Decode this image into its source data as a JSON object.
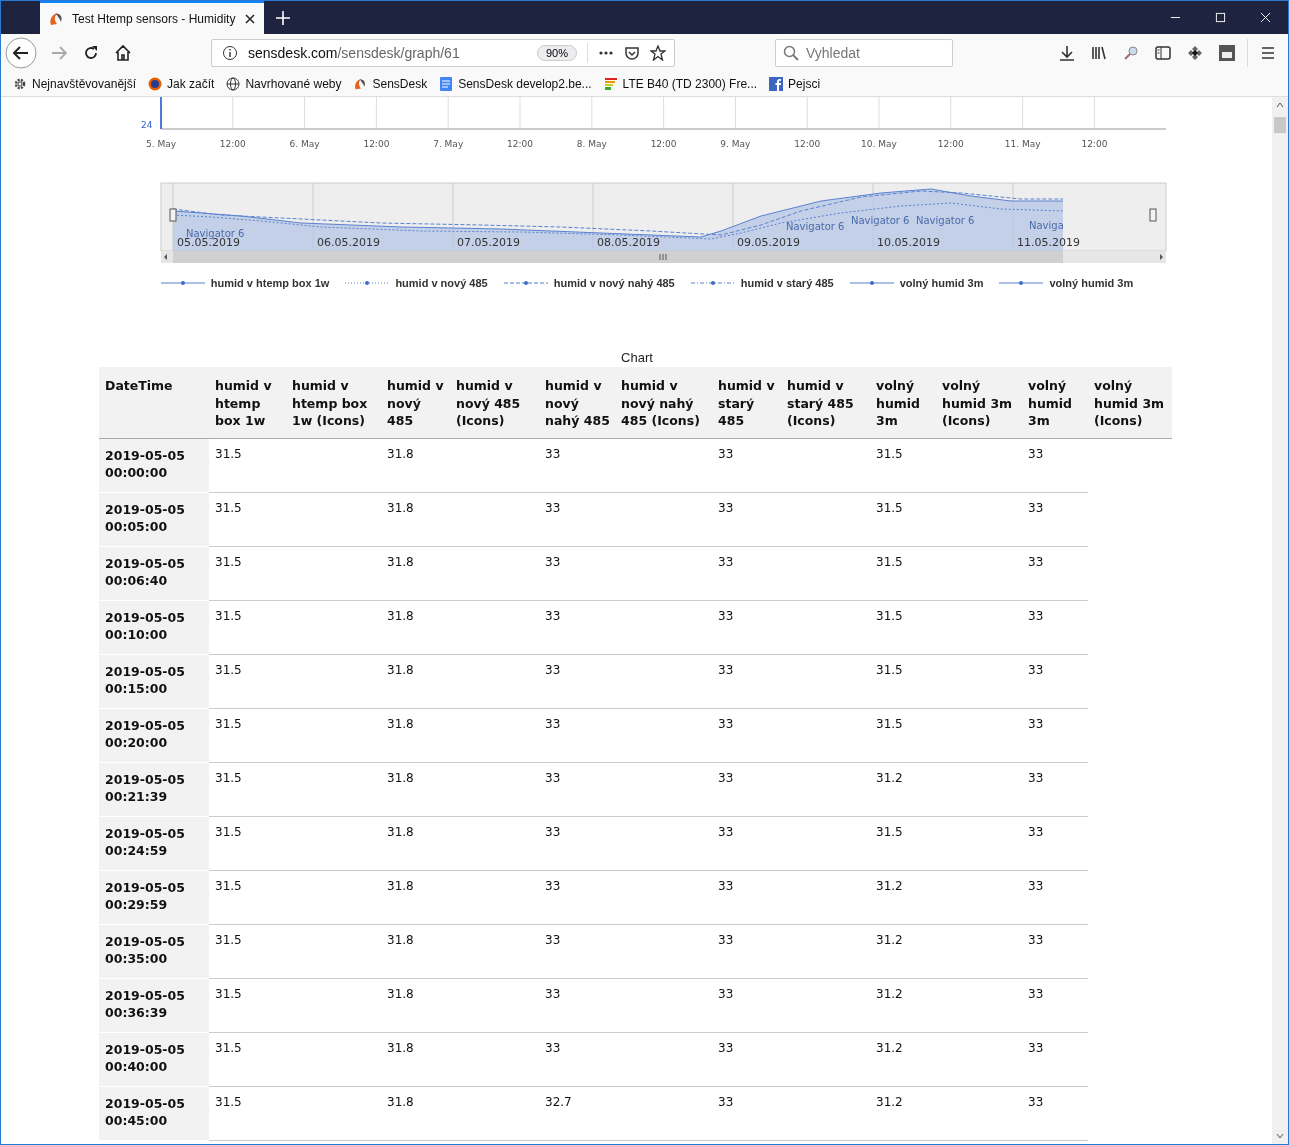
{
  "browser": {
    "tab_title": "Test Htemp sensors - Humidity",
    "url_host": "sensdesk.com",
    "url_path": "/sensdesk/graph/61",
    "zoom": "90%",
    "search_placeholder": "Vyhledat",
    "bookmarks": [
      "Nejnavštěvovanější",
      "Jak začít",
      "Navrhované weby",
      "SensDesk",
      "SensDesk develop2.be...",
      "LTE B40 (TD 2300) Fre...",
      "Pejsci"
    ]
  },
  "chart": {
    "y_label": "24",
    "x_labels": [
      "5. May",
      "12:00",
      "6. May",
      "12:00",
      "7. May",
      "12:00",
      "8. May",
      "12:00",
      "9. May",
      "12:00",
      "10. May",
      "12:00",
      "11. May",
      "12:00"
    ],
    "navigator": {
      "dates": [
        "05.05.2019",
        "06.05.2019",
        "07.05.2019",
        "08.05.2019",
        "09.05.2019",
        "10.05.2019",
        "11.05.2019"
      ],
      "series_labels": [
        "Navigator 6",
        "Navigator 6",
        "Navigator 6",
        "Navigator 6",
        "Naviga"
      ]
    },
    "legend": [
      {
        "name": "humid v htemp box 1w",
        "kind": "solid"
      },
      {
        "name": "humid v nový 485",
        "kind": "dotted"
      },
      {
        "name": "humid v nový nahý 485",
        "kind": "dashed"
      },
      {
        "name": "humid v starý 485",
        "kind": "dashdot"
      },
      {
        "name": "volný humid 3m",
        "kind": "solid"
      },
      {
        "name": "volný humid 3m",
        "kind": "solid"
      }
    ]
  },
  "table": {
    "caption": "Chart",
    "columns": [
      {
        "label": "DateTime",
        "kind": "datetime"
      },
      {
        "label": "humid v htemp box 1w",
        "kind": "value"
      },
      {
        "label": "humid v htemp box 1w (Icons)",
        "kind": "icons"
      },
      {
        "label": "humid v nový 485",
        "kind": "value"
      },
      {
        "label": "humid v nový 485 (Icons)",
        "kind": "icons"
      },
      {
        "label": "humid v nový nahý 485",
        "kind": "value"
      },
      {
        "label": "humid v nový nahý 485 (Icons)",
        "kind": "icons"
      },
      {
        "label": "humid v starý 485",
        "kind": "value"
      },
      {
        "label": "humid v starý 485 (Icons)",
        "kind": "icons"
      },
      {
        "label": "volný humid 3m",
        "kind": "value"
      },
      {
        "label": "volný humid 3m (Icons)",
        "kind": "icons"
      },
      {
        "label": "volný humid 3m",
        "kind": "value"
      },
      {
        "label": "volný humid 3m (Icons)",
        "kind": "icons"
      }
    ],
    "rows": [
      {
        "datetime": "2019-05-05 00:00:00",
        "values": [
          "31.5",
          "31.8",
          "33",
          "33",
          "31.5",
          "33"
        ]
      },
      {
        "datetime": "2019-05-05 00:05:00",
        "values": [
          "31.5",
          "31.8",
          "33",
          "33",
          "31.5",
          "33"
        ]
      },
      {
        "datetime": "2019-05-05 00:06:40",
        "values": [
          "31.5",
          "31.8",
          "33",
          "33",
          "31.5",
          "33"
        ]
      },
      {
        "datetime": "2019-05-05 00:10:00",
        "values": [
          "31.5",
          "31.8",
          "33",
          "33",
          "31.5",
          "33"
        ]
      },
      {
        "datetime": "2019-05-05 00:15:00",
        "values": [
          "31.5",
          "31.8",
          "33",
          "33",
          "31.5",
          "33"
        ]
      },
      {
        "datetime": "2019-05-05 00:20:00",
        "values": [
          "31.5",
          "31.8",
          "33",
          "33",
          "31.5",
          "33"
        ]
      },
      {
        "datetime": "2019-05-05 00:21:39",
        "values": [
          "31.5",
          "31.8",
          "33",
          "33",
          "31.2",
          "33"
        ]
      },
      {
        "datetime": "2019-05-05 00:24:59",
        "values": [
          "31.5",
          "31.8",
          "33",
          "33",
          "31.5",
          "33"
        ]
      },
      {
        "datetime": "2019-05-05 00:29:59",
        "values": [
          "31.5",
          "31.8",
          "33",
          "33",
          "31.2",
          "33"
        ]
      },
      {
        "datetime": "2019-05-05 00:35:00",
        "values": [
          "31.5",
          "31.8",
          "33",
          "33",
          "31.2",
          "33"
        ]
      },
      {
        "datetime": "2019-05-05 00:36:39",
        "values": [
          "31.5",
          "31.8",
          "33",
          "33",
          "31.2",
          "33"
        ]
      },
      {
        "datetime": "2019-05-05 00:40:00",
        "values": [
          "31.5",
          "31.8",
          "33",
          "33",
          "31.2",
          "33"
        ]
      },
      {
        "datetime": "2019-05-05 00:45:00",
        "values": [
          "31.5",
          "31.8",
          "32.7",
          "33",
          "31.2",
          "33"
        ]
      }
    ]
  }
}
